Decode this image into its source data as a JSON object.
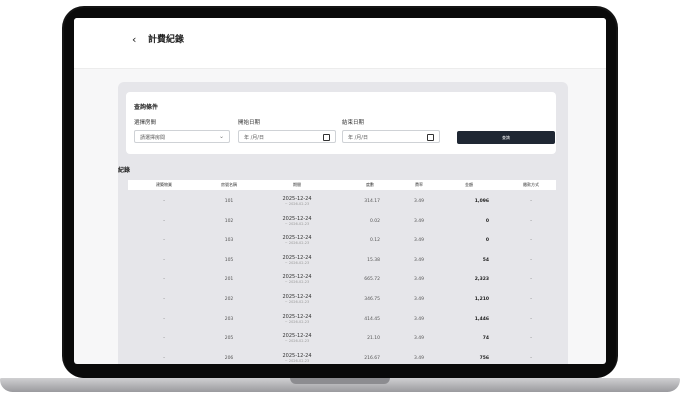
{
  "header": {
    "back_icon": "‹",
    "title": "計費紀錄"
  },
  "filter": {
    "title": "查詢條件",
    "room_label": "選擇房間",
    "room_value": "請選擇房間",
    "start_label": "開始日期",
    "start_placeholder": "年 /月/日",
    "end_label": "結束日期",
    "end_placeholder": "年 /月/日",
    "query_button": "查詢"
  },
  "records": {
    "title": "紀錄",
    "columns": [
      "建築物業",
      "房號名稱",
      "期間",
      "度數",
      "費率",
      "金額",
      "繳款方式"
    ],
    "rows": [
      {
        "building": "-",
        "room": "101",
        "period": "2025-12-24",
        "period_end": "~ 2026-02-23",
        "kwh": "314.17",
        "rate": "3.49",
        "amount": "1,096",
        "method": "-"
      },
      {
        "building": "-",
        "room": "102",
        "period": "2025-12-24",
        "period_end": "~ 2026-02-23",
        "kwh": "0.02",
        "rate": "3.49",
        "amount": "0",
        "method": "-"
      },
      {
        "building": "-",
        "room": "103",
        "period": "2025-12-24",
        "period_end": "~ 2026-02-23",
        "kwh": "0.12",
        "rate": "3.49",
        "amount": "0",
        "method": "-"
      },
      {
        "building": "-",
        "room": "105",
        "period": "2025-12-24",
        "period_end": "~ 2026-02-23",
        "kwh": "15.38",
        "rate": "3.49",
        "amount": "54",
        "method": "-"
      },
      {
        "building": "-",
        "room": "201",
        "period": "2025-12-24",
        "period_end": "~ 2026-02-23",
        "kwh": "665.72",
        "rate": "3.49",
        "amount": "2,323",
        "method": "-"
      },
      {
        "building": "-",
        "room": "202",
        "period": "2025-12-24",
        "period_end": "~ 2026-02-23",
        "kwh": "346.75",
        "rate": "3.49",
        "amount": "1,210",
        "method": "-"
      },
      {
        "building": "-",
        "room": "203",
        "period": "2025-12-24",
        "period_end": "~ 2026-02-23",
        "kwh": "414.45",
        "rate": "3.49",
        "amount": "1,446",
        "method": "-"
      },
      {
        "building": "-",
        "room": "205",
        "period": "2025-12-24",
        "period_end": "~ 2026-02-23",
        "kwh": "21.10",
        "rate": "3.49",
        "amount": "74",
        "method": "-"
      },
      {
        "building": "-",
        "room": "206",
        "period": "2025-12-24",
        "period_end": "~ 2026-02-23",
        "kwh": "216.67",
        "rate": "3.49",
        "amount": "756",
        "method": "-"
      }
    ]
  }
}
